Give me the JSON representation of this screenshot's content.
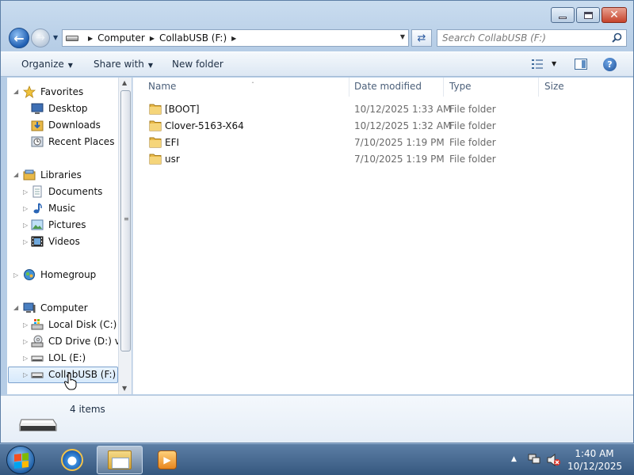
{
  "window": {
    "caption": {
      "minimize": "–",
      "maximize": "□",
      "close": "✕"
    }
  },
  "address": {
    "crumbs": [
      "Computer",
      "CollabUSB (F:)"
    ],
    "search_placeholder": "Search CollabUSB (F:)"
  },
  "toolbar": {
    "organize": "Organize",
    "share_with": "Share with",
    "new_folder": "New folder",
    "help": "?"
  },
  "nav": {
    "favorites": {
      "label": "Favorites",
      "items": [
        "Desktop",
        "Downloads",
        "Recent Places"
      ]
    },
    "libraries": {
      "label": "Libraries",
      "items": [
        "Documents",
        "Music",
        "Pictures",
        "Videos"
      ]
    },
    "homegroup": "Homegroup",
    "computer": {
      "label": "Computer",
      "items": [
        "Local Disk (C:)",
        "CD Drive (D:) virt",
        "LOL (E:)",
        "CollabUSB (F:)"
      ]
    }
  },
  "columns": {
    "name": "Name",
    "date": "Date modified",
    "type": "Type",
    "size": "Size"
  },
  "files": [
    {
      "name": "[BOOT]",
      "date": "10/12/2025 1:33 AM",
      "type": "File folder"
    },
    {
      "name": "Clover-5163-X64",
      "date": "10/12/2025 1:32 AM",
      "type": "File folder"
    },
    {
      "name": "EFI",
      "date": "7/10/2025 1:19 PM",
      "type": "File folder"
    },
    {
      "name": "usr",
      "date": "7/10/2025 1:19 PM",
      "type": "File folder"
    }
  ],
  "details": {
    "count": "4 items"
  },
  "taskbar": {
    "time": "1:40 AM",
    "date": "10/12/2025"
  },
  "colors": {
    "selection": "#d6e9fb",
    "folder": "#e9b948",
    "accent": "#1f5fb3"
  }
}
